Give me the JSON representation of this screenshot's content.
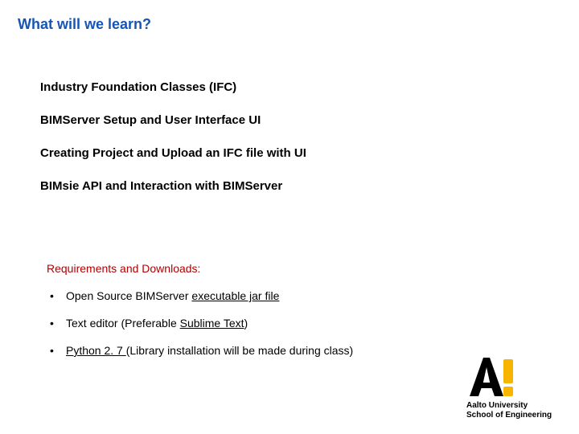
{
  "title": "What will we learn?",
  "topics": [
    "Industry Foundation Classes (IFC)",
    "BIMServer Setup and User Interface UI",
    "Creating Project and Upload an IFC file with UI",
    "BIMsie API and Interaction with BIMServer"
  ],
  "requirements": {
    "heading": "Requirements and Downloads:",
    "items": [
      {
        "pre": "Open Source BIMServer ",
        "link": "executable jar file",
        "post": ""
      },
      {
        "pre": "Text editor (Preferable ",
        "link": "Sublime Text",
        "post": ")"
      },
      {
        "pre": "",
        "link": "Python 2. 7 ",
        "post": "(Library installation will be made during class)"
      }
    ]
  },
  "logo": {
    "line1": "Aalto University",
    "line2": "School of Engineering"
  }
}
